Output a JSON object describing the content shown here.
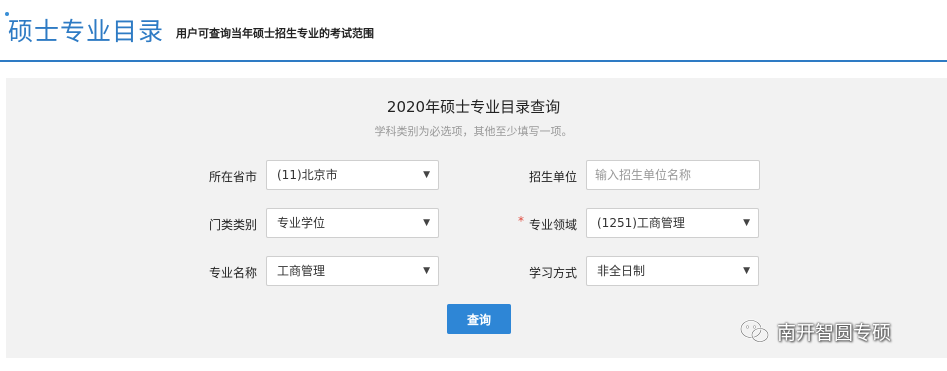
{
  "header": {
    "title": "硕士专业目录",
    "subtitle": "用户可查询当年硕士招生专业的考试范围"
  },
  "form": {
    "title": "2020年硕士专业目录查询",
    "hint": "学科类别为必选项，其他至少填写一项。",
    "province": {
      "label": "所在省市",
      "value": "(11)北京市"
    },
    "unit": {
      "label": "招生单位",
      "placeholder": "输入招生单位名称",
      "value": ""
    },
    "category": {
      "label": "门类类别",
      "value": "专业学位"
    },
    "field": {
      "label": "专业领域",
      "required_mark": "*",
      "value": "(1251)工商管理"
    },
    "major": {
      "label": "专业名称",
      "value": "工商管理"
    },
    "mode": {
      "label": "学习方式",
      "value": "非全日制"
    },
    "submit_label": "查询"
  },
  "watermark": {
    "text": "南开智圆专硕",
    "icon": "wechat-icon"
  },
  "colors": {
    "accent": "#2e7bc4",
    "button": "#2e86d6",
    "panel": "#f2f2f2",
    "required": "#e0483c"
  }
}
